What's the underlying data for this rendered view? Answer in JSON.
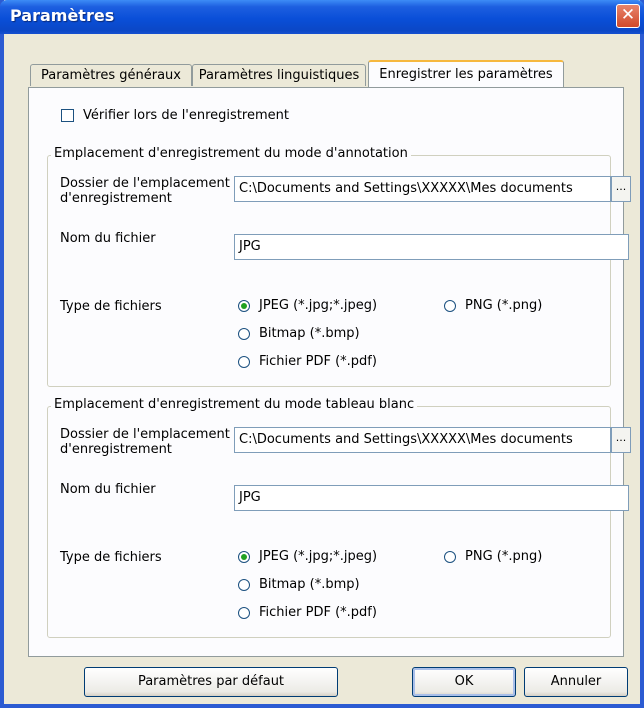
{
  "window": {
    "title": "Paramètres",
    "close_glyph": "✕"
  },
  "tabs": [
    {
      "label": "Paramètres généraux"
    },
    {
      "label": "Paramètres linguistiques"
    },
    {
      "label": "Enregistrer les paramètres",
      "active": true
    }
  ],
  "verify_checkbox": {
    "label": "Vérifier lors de l'enregistrement",
    "checked": false
  },
  "groups": [
    {
      "title": "Emplacement d'enregistrement du mode d'annotation",
      "folder_label": "Dossier de l'emplacement d'enregistrement",
      "folder_value": "C:\\Documents and Settings\\XXXXX\\Mes documents",
      "browse_label": "...",
      "filename_label": "Nom du fichier",
      "filename_value": "JPG",
      "filetype_label": "Type de fichiers",
      "filetype_options": [
        "JPEG (*.jpg;*.jpeg)",
        "PNG (*.png)",
        "Bitmap (*.bmp)",
        "Fichier PDF (*.pdf)"
      ],
      "filetype_selected": "JPEG (*.jpg;*.jpeg)"
    },
    {
      "title": "Emplacement d'enregistrement du mode tableau blanc",
      "folder_label": "Dossier de l'emplacement d'enregistrement",
      "folder_value": "C:\\Documents and Settings\\XXXXX\\Mes documents",
      "browse_label": "...",
      "filename_label": "Nom du fichier",
      "filename_value": "JPG",
      "filetype_label": "Type de fichiers",
      "filetype_options": [
        "JPEG (*.jpg;*.jpeg)",
        "PNG (*.png)",
        "Bitmap (*.bmp)",
        "Fichier PDF (*.pdf)"
      ],
      "filetype_selected": "JPEG (*.jpg;*.jpeg)"
    }
  ],
  "buttons": {
    "defaults": "Paramètres par défaut",
    "ok": "OK",
    "cancel": "Annuler"
  },
  "colors": {
    "title_bar": "#0a4fd8",
    "window_face": "#ece9d8",
    "close_button": "#d0492a",
    "radio_selected": "#21a121"
  }
}
